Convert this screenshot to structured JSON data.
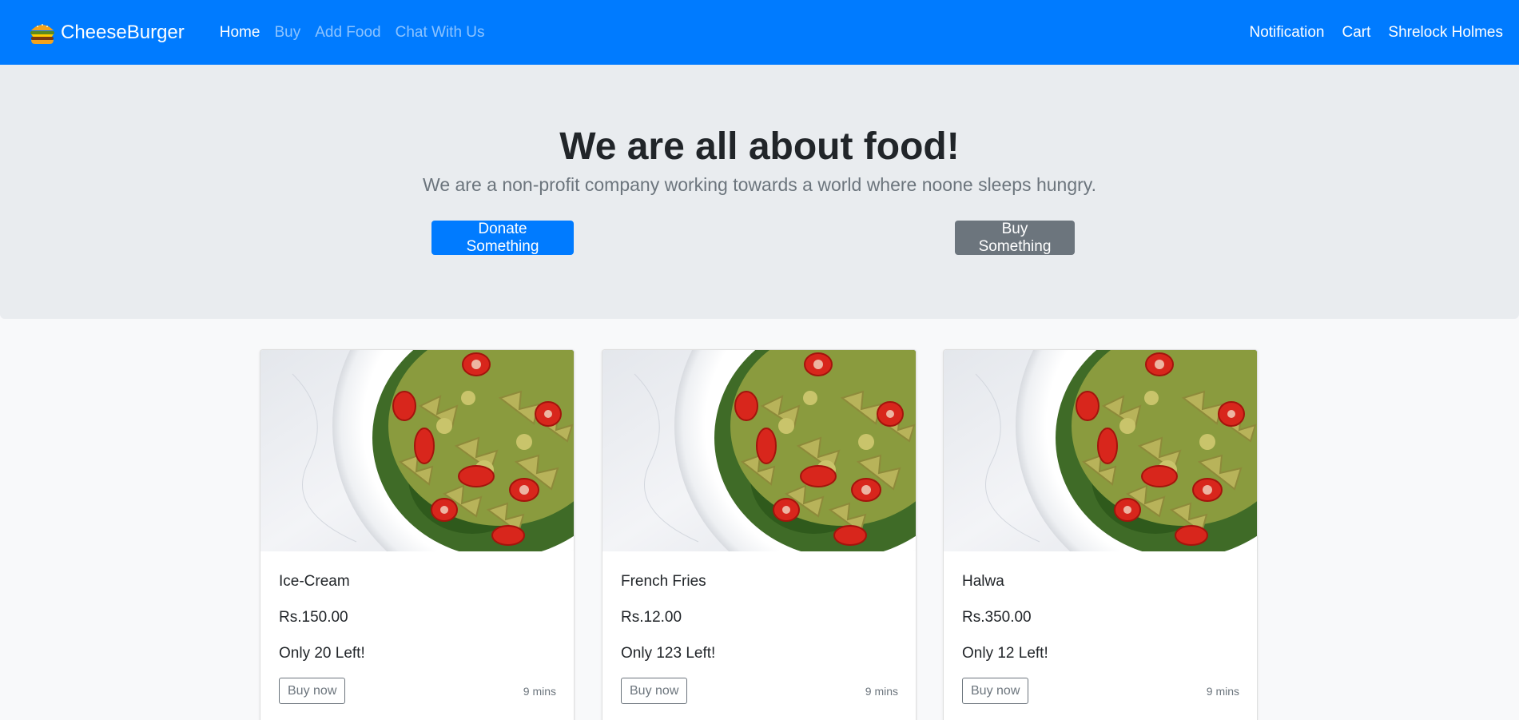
{
  "navbar": {
    "brand": "CheeseBurger",
    "links": [
      "Home",
      "Buy",
      "Add Food",
      "Chat With Us"
    ],
    "right_links": [
      "Notification",
      "Cart",
      "Shrelock Holmes"
    ],
    "color": "#007bff"
  },
  "hero": {
    "title": "We are all about food!",
    "lead": "We are a non-profit company working towards a world where noone sleeps hungry.",
    "donate_label": "Donate Something",
    "buy_label": "Buy Something"
  },
  "cards": [
    {
      "name": "Ice-Cream",
      "price": "Rs.150.00",
      "stock": "Only 20 Left!",
      "button": "Buy now",
      "time": "9 mins"
    },
    {
      "name": "French Fries",
      "price": "Rs.12.00",
      "stock": "Only 123 Left!",
      "button": "Buy now",
      "time": "9 mins"
    },
    {
      "name": "Halwa",
      "price": "Rs.350.00",
      "stock": "Only 12 Left!",
      "button": "Buy now",
      "time": "9 mins"
    }
  ],
  "icons": {
    "brand": "burger-icon",
    "card_image": "pasta-salad-image"
  }
}
